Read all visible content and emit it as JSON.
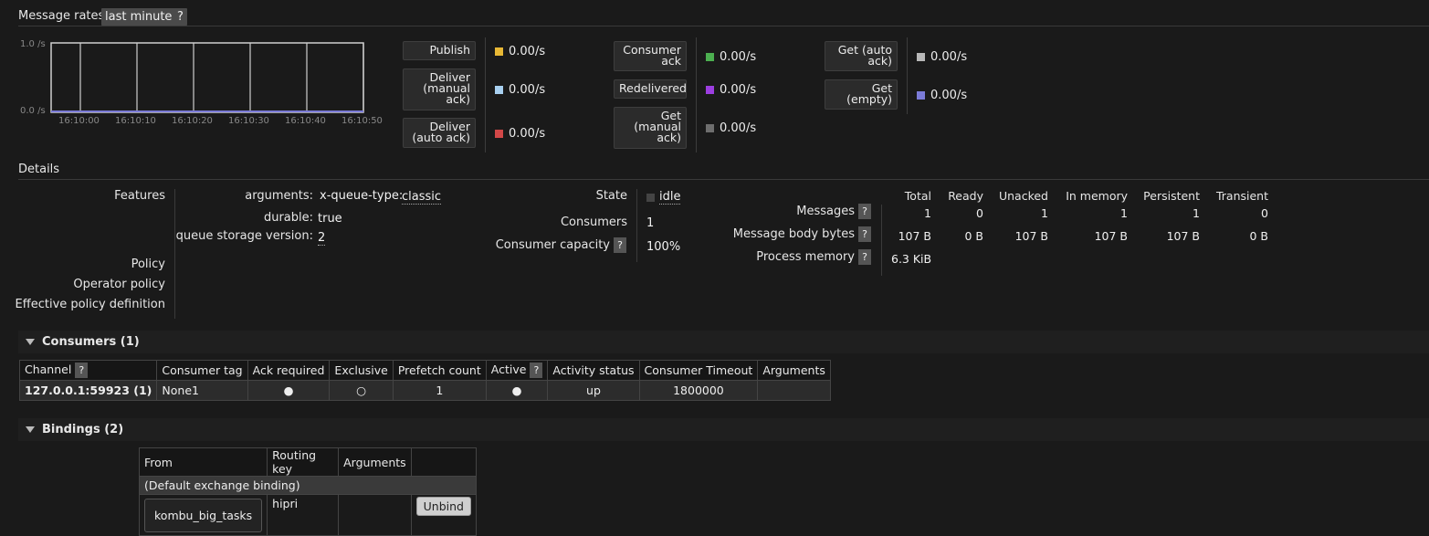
{
  "message_rates": {
    "title": "Message rates",
    "period": "last minute",
    "help": "?"
  },
  "chart_data": {
    "type": "line",
    "x": [
      "16:10:00",
      "16:10:10",
      "16:10:20",
      "16:10:30",
      "16:10:40",
      "16:10:50"
    ],
    "y_ticks": [
      "1.0 /s",
      "0.0 /s"
    ],
    "ylim": [
      0,
      1
    ],
    "series": [
      {
        "name": "Publish",
        "values": [
          0,
          0,
          0,
          0,
          0,
          0
        ]
      },
      {
        "name": "Deliver (auto ack)",
        "values": [
          0,
          0,
          0,
          0,
          0,
          0
        ]
      }
    ],
    "line_color": "#7b7bd8"
  },
  "rates": {
    "publish": {
      "label": "Publish",
      "value": "0.00/s",
      "color": "#e8b835"
    },
    "deliver_manual": {
      "label_lines": [
        "Deliver",
        "(manual",
        "ack)"
      ],
      "value": "0.00/s",
      "color": "#a8d0f0"
    },
    "deliver_auto": {
      "label_lines": [
        "Deliver",
        "(auto ack)"
      ],
      "value": "0.00/s",
      "color": "#d24848"
    },
    "consumer_ack": {
      "label_lines": [
        "Consumer",
        "ack"
      ],
      "value": "0.00/s",
      "color": "#4caf50"
    },
    "redelivered": {
      "label": "Redelivered",
      "value": "0.00/s",
      "color": "#9c3ee0"
    },
    "get_manual": {
      "label_lines": [
        "Get",
        "(manual",
        "ack)"
      ],
      "value": "0.00/s",
      "color": "#6e6e6e"
    },
    "get_auto": {
      "label_lines": [
        "Get (auto",
        "ack)"
      ],
      "value": "0.00/s",
      "color": "#b8b8b8"
    },
    "get_empty": {
      "label_lines": [
        "Get",
        "(empty)"
      ],
      "value": "0.00/s",
      "color": "#7b7bd8"
    }
  },
  "details": {
    "title": "Details",
    "features_label": "Features",
    "arguments_label": "arguments:",
    "arg_key": "x-queue-type:",
    "arg_val": "classic",
    "durable_label": "durable:",
    "durable_val": "true",
    "qsv_label": "queue storage version:",
    "qsv_val": "2",
    "policy_label": "Policy",
    "operator_policy_label": "Operator policy",
    "effective_policy_label": "Effective policy definition",
    "state_label": "State",
    "state_val": "idle",
    "consumers_label": "Consumers",
    "consumers_val": "1",
    "capacity_label": "Consumer capacity",
    "capacity_val": "100%",
    "columns": [
      "Total",
      "Ready",
      "Unacked",
      "In memory",
      "Persistent",
      "Transient"
    ],
    "messages_label": "Messages",
    "messages": [
      "1",
      "0",
      "1",
      "1",
      "1",
      "0"
    ],
    "body_bytes_label": "Message body bytes",
    "body_bytes": [
      "107 B",
      "0 B",
      "107 B",
      "107 B",
      "107 B",
      "0 B"
    ],
    "process_memory_label": "Process memory",
    "process_memory": "6.3 KiB"
  },
  "consumers": {
    "header": "Consumers (1)",
    "columns": [
      "Channel",
      "Consumer tag",
      "Ack required",
      "Exclusive",
      "Prefetch count",
      "Active",
      "Activity status",
      "Consumer Timeout",
      "Arguments"
    ],
    "row": {
      "channel": "127.0.0.1:59923 (1)",
      "tag": "None1",
      "ack_required": "●",
      "exclusive": "○",
      "prefetch": "1",
      "active": "●",
      "activity_status": "up",
      "timeout": "1800000",
      "arguments": ""
    }
  },
  "bindings": {
    "header": "Bindings (2)",
    "columns": [
      "From",
      "Routing key",
      "Arguments"
    ],
    "default_binding": "(Default exchange binding)",
    "exchange": "kombu_big_tasks",
    "routing_key": "hipri",
    "unbind_label": "Unbind"
  }
}
